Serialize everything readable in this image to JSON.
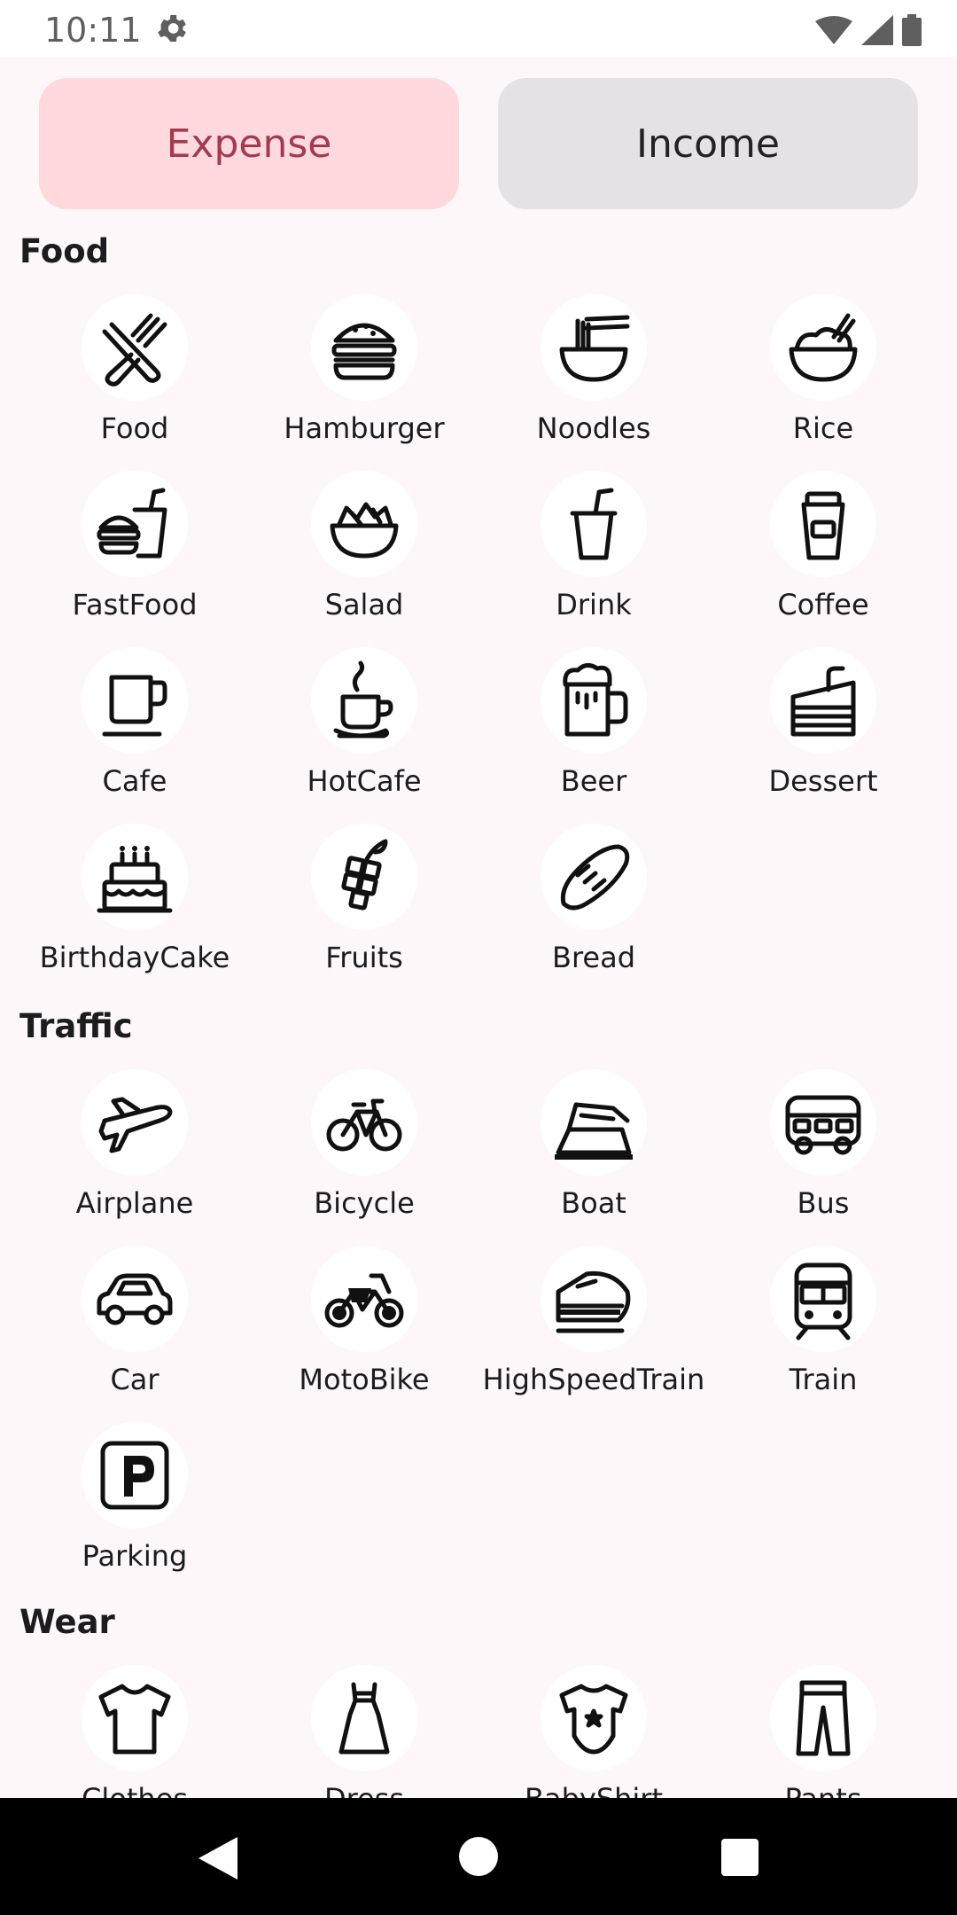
{
  "status": {
    "time": "10:11"
  },
  "toggle": {
    "expense": "Expense",
    "income": "Income"
  },
  "sections": [
    {
      "title": "Food",
      "items": [
        {
          "label": "Food",
          "icon": "fork-knife-icon"
        },
        {
          "label": "Hamburger",
          "icon": "hamburger-icon"
        },
        {
          "label": "Noodles",
          "icon": "noodles-icon"
        },
        {
          "label": "Rice",
          "icon": "rice-bowl-icon"
        },
        {
          "label": "FastFood",
          "icon": "fast-food-icon"
        },
        {
          "label": "Salad",
          "icon": "salad-icon"
        },
        {
          "label": "Drink",
          "icon": "drink-cup-icon"
        },
        {
          "label": "Coffee",
          "icon": "coffee-cup-icon"
        },
        {
          "label": "Cafe",
          "icon": "cafe-mug-icon"
        },
        {
          "label": "HotCafe",
          "icon": "hot-cafe-icon"
        },
        {
          "label": "Beer",
          "icon": "beer-icon"
        },
        {
          "label": "Dessert",
          "icon": "dessert-icon"
        },
        {
          "label": "BirthdayCake",
          "icon": "birthday-cake-icon"
        },
        {
          "label": "Fruits",
          "icon": "grapes-icon"
        },
        {
          "label": "Bread",
          "icon": "bread-icon"
        }
      ]
    },
    {
      "title": "Traffic",
      "items": [
        {
          "label": "Airplane",
          "icon": "airplane-icon"
        },
        {
          "label": "Bicycle",
          "icon": "bicycle-icon"
        },
        {
          "label": "Boat",
          "icon": "boat-icon"
        },
        {
          "label": "Bus",
          "icon": "bus-icon"
        },
        {
          "label": "Car",
          "icon": "car-icon"
        },
        {
          "label": "MotoBike",
          "icon": "motorbike-icon"
        },
        {
          "label": "HighSpeedTrain",
          "icon": "high-speed-train-icon"
        },
        {
          "label": "Train",
          "icon": "train-icon"
        },
        {
          "label": "Parking",
          "icon": "parking-icon"
        }
      ]
    },
    {
      "title": "Wear",
      "items": [
        {
          "label": "Clothes",
          "icon": "tshirt-icon"
        },
        {
          "label": "Dress",
          "icon": "dress-icon"
        },
        {
          "label": "BabyShirt",
          "icon": "baby-shirt-icon"
        },
        {
          "label": "Pants",
          "icon": "pants-icon"
        }
      ]
    }
  ]
}
